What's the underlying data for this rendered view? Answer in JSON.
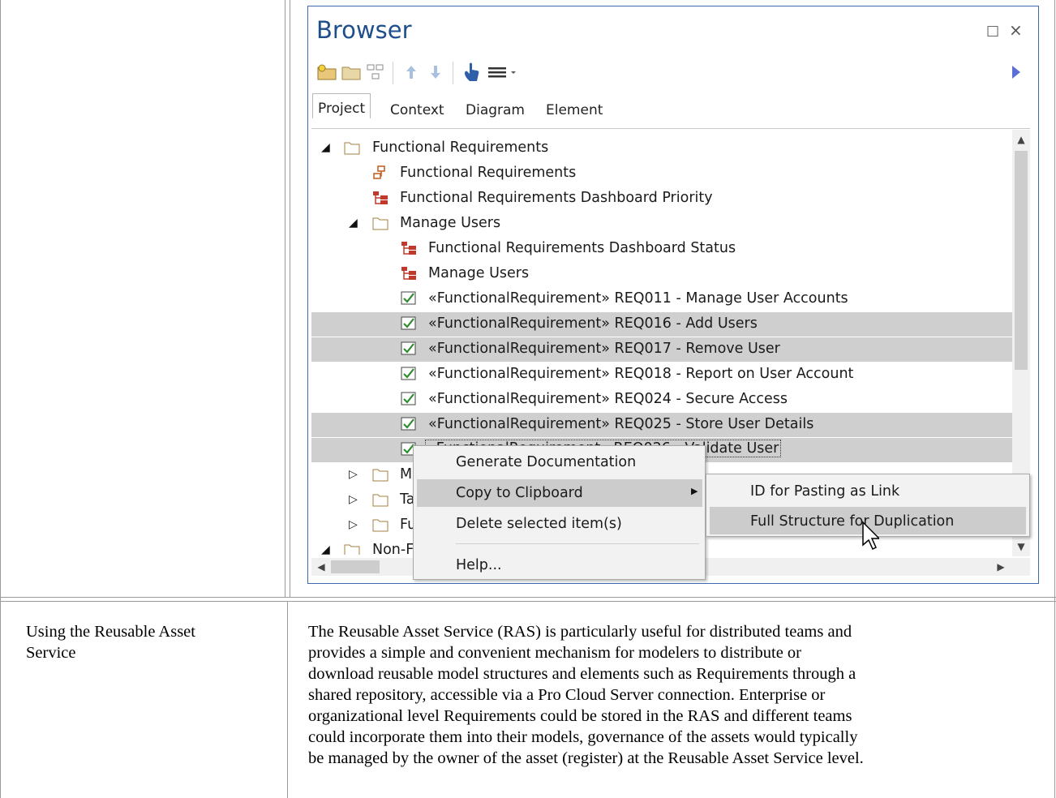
{
  "browser": {
    "title": "Browser",
    "maximize_glyph": "□",
    "close_glyph": "×",
    "tabs": [
      {
        "label": "Project"
      },
      {
        "label": "Context"
      },
      {
        "label": "Diagram"
      },
      {
        "label": "Element"
      }
    ],
    "tree": [
      {
        "label": "Functional Requirements",
        "icon": "folder-icon"
      },
      {
        "label": "Functional Requirements",
        "icon": "package-diagram-icon"
      },
      {
        "label": "Functional Requirements Dashboard Priority",
        "icon": "dashboard-diagram-icon"
      },
      {
        "label": "Manage Users",
        "icon": "folder-icon"
      },
      {
        "label": "Functional Requirements Dashboard Status",
        "icon": "dashboard-diagram-icon"
      },
      {
        "label": "Manage Users",
        "icon": "dashboard-diagram-icon"
      },
      {
        "label": "«FunctionalRequirement» REQ011 - Manage User Accounts",
        "icon": "requirement-icon"
      },
      {
        "label": "«FunctionalRequirement» REQ016 - Add Users",
        "icon": "requirement-icon"
      },
      {
        "label": "«FunctionalRequirement» REQ017 - Remove User",
        "icon": "requirement-icon"
      },
      {
        "label": "«FunctionalRequirement» REQ018 - Report on User Account",
        "icon": "requirement-icon"
      },
      {
        "label": "«FunctionalRequirement» REQ024 - Secure Access",
        "icon": "requirement-icon"
      },
      {
        "label": "«FunctionalRequirement» REQ025 - Store User Details",
        "icon": "requirement-icon"
      },
      {
        "label": "«FunctionalRequirement» REQ026 - Validate User",
        "icon": "requirement-icon"
      },
      {
        "label": "M",
        "icon": "folder-icon"
      },
      {
        "label": "Ta",
        "icon": "folder-icon"
      },
      {
        "label": "Fu",
        "icon": "folder-icon"
      },
      {
        "label": "Non-F",
        "icon": "folder-icon"
      }
    ]
  },
  "context_menu": {
    "items": [
      {
        "label": "Generate Documentation"
      },
      {
        "label": "Copy to Clipboard"
      },
      {
        "label": "Delete selected item(s)"
      },
      {
        "label": "Help..."
      }
    ]
  },
  "submenu": {
    "items": [
      {
        "label": "ID for Pasting as Link"
      },
      {
        "label": "Full Structure for Duplication"
      }
    ]
  },
  "doc": {
    "row_label": "Using the Reusable Asset Service",
    "row_label_line1": "Using the Reusable Asset",
    "row_label_line2": "Service",
    "description_lines": [
      "The Reusable Asset Service (RAS) is particularly useful for distributed teams and",
      "provides a simple and convenient mechanism for modelers to distribute or",
      "download reusable model structures and elements such as Requirements through a",
      "shared repository, accessible via a Pro Cloud Server connection. Enterprise or",
      "organizational level Requirements could be stored in the RAS and different teams",
      "could incorporate them into their models, governance of the assets would typically",
      "be managed by the owner of the asset (register) at the Reusable Asset Service level."
    ]
  },
  "colors": {
    "title_blue": "#1f4e8c",
    "selection_gray": "#cfcfcf",
    "requirement_green": "#2e8b2e",
    "diagram_red": "#c0392b"
  }
}
